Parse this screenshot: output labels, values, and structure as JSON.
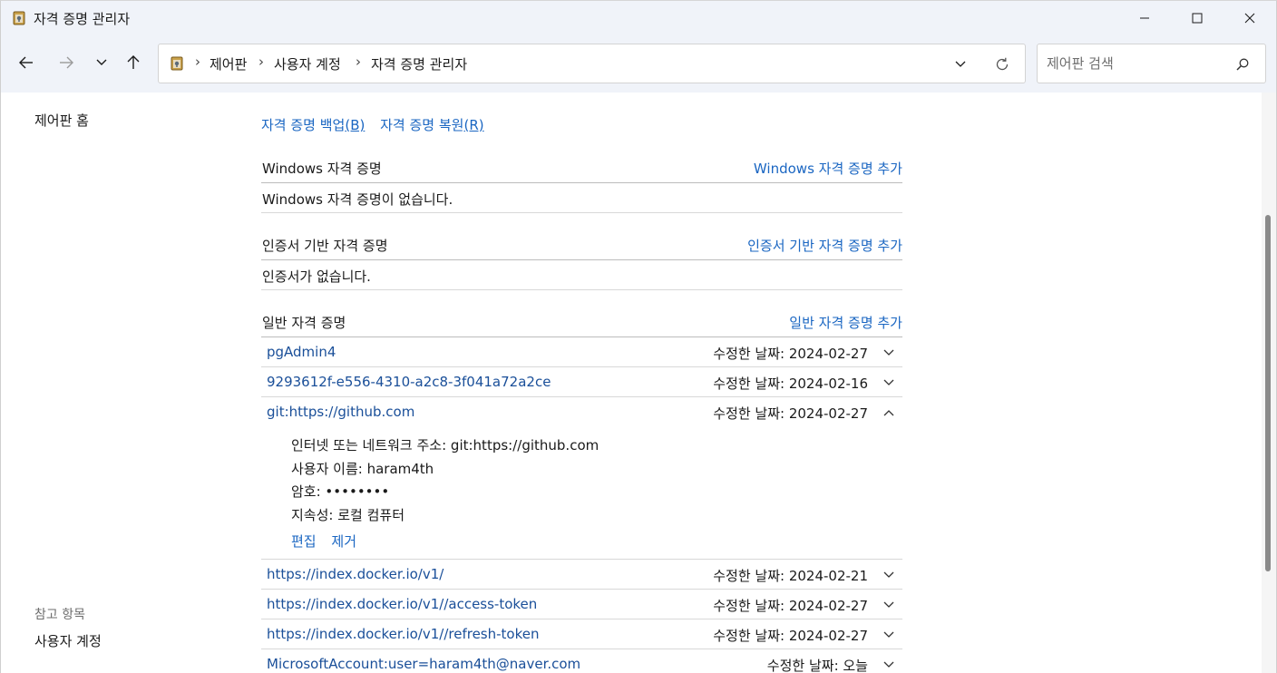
{
  "window": {
    "title": "자격 증명 관리자"
  },
  "address_bar": {
    "breadcrumbs": [
      "제어판",
      "사용자 계정",
      "자격 증명 관리자"
    ]
  },
  "search": {
    "placeholder": "제어판 검색"
  },
  "sidebar": {
    "home_label": "제어판 홈",
    "see_also_label": "참고 항목",
    "see_also_link": "사용자 계정"
  },
  "actions": {
    "backup_label": "자격 증명 백업",
    "backup_key": "(B)",
    "restore_label": "자격 증명 복원",
    "restore_key": "(R)"
  },
  "sections": {
    "windows": {
      "title": "Windows 자격 증명",
      "add_label": "Windows 자격 증명 추가",
      "empty_text": "Windows 자격 증명이 없습니다."
    },
    "certificate": {
      "title": "인증서 기반 자격 증명",
      "add_label": "인증서 기반 자격 증명 추가",
      "empty_text": "인증서가 없습니다."
    },
    "generic": {
      "title": "일반 자격 증명",
      "add_label": "일반 자격 증명 추가"
    }
  },
  "generic_credentials": [
    {
      "name": "pgAdmin4",
      "date": "수정한 날짜:  2024-02-27"
    },
    {
      "name": "9293612f-e556-4310-a2c8-3f041a72a2ce",
      "date": "수정한 날짜:  2024-02-16"
    },
    {
      "name": "git:https://github.com",
      "date": "수정한 날짜:  2024-02-27"
    },
    {
      "name": "https://index.docker.io/v1/",
      "date": "수정한 날짜:  2024-02-21"
    },
    {
      "name": "https://index.docker.io/v1//access-token",
      "date": "수정한 날짜:  2024-02-27"
    },
    {
      "name": "https://index.docker.io/v1//refresh-token",
      "date": "수정한 날짜:  2024-02-27"
    },
    {
      "name": "MicrosoftAccount:user=haram4th@naver.com",
      "date": "수정한 날짜:  오늘"
    }
  ],
  "expanded_detail": {
    "address_line": "인터넷 또는 네트워크 주소:  git:https://github.com",
    "username_line": "사용자 이름:  haram4th",
    "password_line": "암호:  ••••••••",
    "persistence_line": "지속성:  로컬 컴퓨터",
    "edit_label": "편집",
    "remove_label": "제거"
  }
}
